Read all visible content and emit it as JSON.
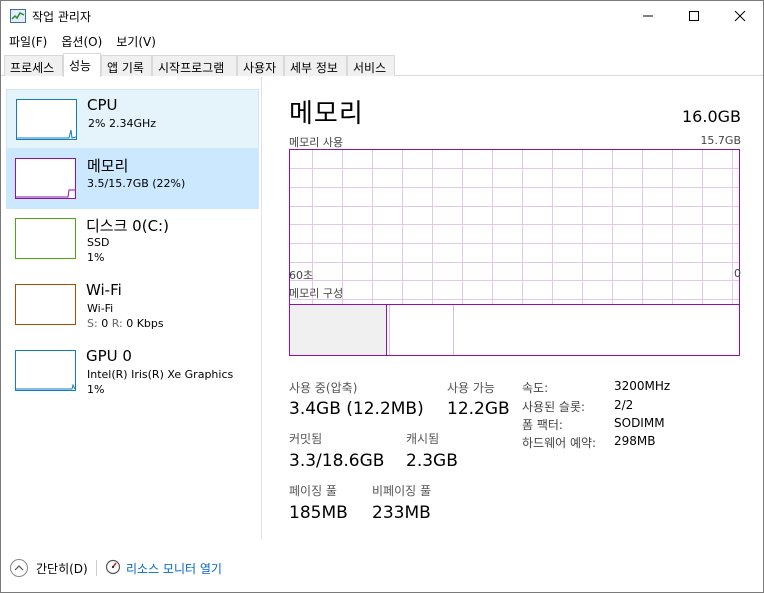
{
  "window": {
    "title": "작업 관리자"
  },
  "menu": {
    "file": "파일(F)",
    "options": "옵션(O)",
    "view": "보기(V)"
  },
  "tabs": [
    "프로세스",
    "성능",
    "앱 기록",
    "시작프로그램",
    "사용자",
    "세부 정보",
    "서비스"
  ],
  "resources": {
    "cpu": {
      "title": "CPU",
      "sub1": "2% 2.34GHz",
      "color": "#117dbb"
    },
    "memory": {
      "title": "메모리",
      "sub1": "3.5/15.7GB (22%)",
      "color": "#8b12ae"
    },
    "disk": {
      "title": "디스크 0(C:)",
      "sub1": "SSD",
      "sub2": "1%",
      "color": "#4da60c"
    },
    "wifi": {
      "title": "Wi-Fi",
      "sub1": "Wi-Fi",
      "sub2_s": "S:",
      "sub2_s_val": "0",
      "sub2_r": "R:",
      "sub2_r_val": "0 Kbps",
      "color": "#a74f01"
    },
    "gpu": {
      "title": "GPU 0",
      "sub1": "Intel(R) Iris(R) Xe Graphics",
      "sub2": "1%",
      "color": "#117dbb"
    }
  },
  "detail": {
    "title": "메모리",
    "capacity": "16.0GB",
    "usage_label": "메모리 사용",
    "usage_max": "15.7GB",
    "time_left": "60초",
    "time_right": "0",
    "composition_label": "메모리 구성"
  },
  "stats": {
    "in_use_label": "사용 중(압축)",
    "in_use_value": "3.4GB (12.2MB)",
    "available_label": "사용 가능",
    "available_value": "12.2GB",
    "committed_label": "커밋됨",
    "committed_value": "3.3/18.6GB",
    "cached_label": "캐시됨",
    "cached_value": "2.3GB",
    "paged_label": "페이징 풀",
    "paged_value": "185MB",
    "nonpaged_label": "비페이징 풀",
    "nonpaged_value": "233MB"
  },
  "specs": {
    "speed_label": "속도:",
    "speed_value": "3200MHz",
    "slots_label": "사용된 슬롯:",
    "slots_value": "2/2",
    "form_label": "폼 팩터:",
    "form_value": "SODIMM",
    "reserved_label": "하드웨어 예약:",
    "reserved_value": "298MB"
  },
  "footer": {
    "collapse": "간단히(D)",
    "resource_monitor": "리소스 모니터 열기"
  },
  "colors": {
    "accent_memory": "#8b12ae",
    "selected_bg": "#cce8ff",
    "link": "#0066cc"
  }
}
